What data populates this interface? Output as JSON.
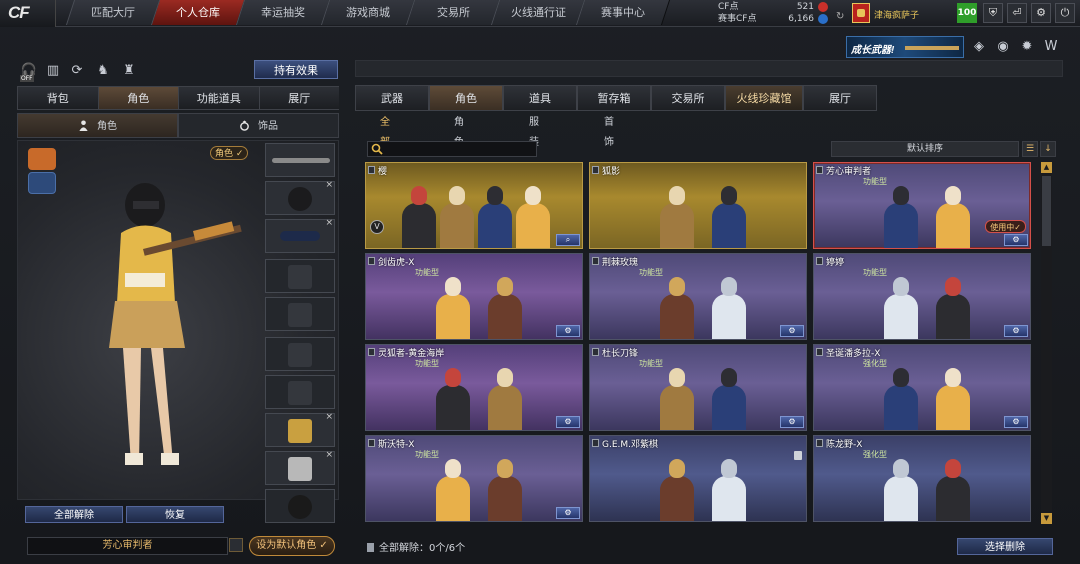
{
  "header": {
    "logo": "CF",
    "tabs": [
      {
        "label": "匹配大厅"
      },
      {
        "label": "个人仓库"
      },
      {
        "label": "幸运抽奖"
      },
      {
        "label": "游戏商城"
      },
      {
        "label": "交易所"
      },
      {
        "label": "火线通行证"
      },
      {
        "label": "赛事中心"
      }
    ],
    "active_tab": "个人仓库",
    "cf_points_label": "CF点",
    "cf_points_value": "521",
    "event_cf_points_label": "赛事CF点",
    "event_cf_points_value": "6,166",
    "refresh_icon": "refresh-icon",
    "username": "津海疯萨子",
    "level": "100",
    "right_icons": [
      "shield-icon",
      "back-icon",
      "settings-icon",
      "power-icon"
    ]
  },
  "promo": {
    "banner_text": "成长武器!",
    "icons": [
      "v-emblem-icon",
      "globe-icon",
      "gear-emblem-icon",
      "w-emblem-icon"
    ]
  },
  "left_panel": {
    "tool_icons": [
      "headset-off-icon",
      "stats-icon",
      "rotate-icon",
      "visibility-icon",
      "bag-icon"
    ],
    "off_label": "OFF",
    "effects_button": "持有效果",
    "tabs": [
      {
        "label": "背包"
      },
      {
        "label": "角色"
      },
      {
        "label": "功能道具"
      },
      {
        "label": "展厅"
      }
    ],
    "active_tab": "角色",
    "subtabs": [
      {
        "label": "角色",
        "icon": "person-icon"
      },
      {
        "label": "饰品",
        "icon": "ring-icon"
      }
    ],
    "role_tag": "角色 ✓",
    "slots": [
      {
        "name": "rifle-slot",
        "removable": false
      },
      {
        "name": "helmet-slot",
        "removable": true
      },
      {
        "name": "goggles-slot",
        "removable": true
      },
      {
        "name": "vest-slot",
        "removable": false
      },
      {
        "name": "armor-slot",
        "removable": false
      },
      {
        "name": "pack-slot",
        "removable": false
      },
      {
        "name": "belt-slot",
        "removable": false
      },
      {
        "name": "gold-knife-slot",
        "removable": true
      },
      {
        "name": "silver-knife-slot",
        "removable": true
      },
      {
        "name": "bracelet-slot",
        "removable": false
      }
    ],
    "unequip_all": "全部解除",
    "restore": "恢复",
    "character_name": "芳心审判者",
    "set_default": "设为默认角色"
  },
  "right_panel": {
    "tabs": [
      {
        "label": "武器"
      },
      {
        "label": "角色"
      },
      {
        "label": "道具"
      },
      {
        "label": "暂存箱"
      },
      {
        "label": "交易所"
      },
      {
        "label": "火线珍藏馆"
      },
      {
        "label": "展厅"
      }
    ],
    "active_tab": "角色",
    "filters": [
      {
        "label": "全部"
      },
      {
        "label": "角色"
      },
      {
        "label": "服装"
      },
      {
        "label": "首饰"
      }
    ],
    "active_filter": "全部",
    "search_placeholder": "",
    "sort_label": "默认排序",
    "cards": [
      {
        "name": "樱",
        "tag": "",
        "color": "gold",
        "figures": 4,
        "action": "search",
        "badge": "V",
        "in_use": ""
      },
      {
        "name": "狐影",
        "tag": "",
        "color": "gold",
        "figures": 2,
        "action": "",
        "badge": "",
        "in_use": ""
      },
      {
        "name": "芳心审判者",
        "tag": "功能型",
        "color": "purple",
        "figures": 2,
        "action": "gear",
        "badge": "",
        "in_use": "使用中✓",
        "selected": true
      },
      {
        "name": "剑齿虎-X",
        "tag": "功能型",
        "color": "violet",
        "figures": 2,
        "action": "gear",
        "badge": "",
        "in_use": ""
      },
      {
        "name": "荆棘玫瑰",
        "tag": "功能型",
        "color": "purple",
        "figures": 2,
        "action": "gear",
        "badge": "",
        "in_use": ""
      },
      {
        "name": "婷婷",
        "tag": "功能型",
        "color": "purple",
        "figures": 2,
        "action": "gear",
        "badge": "",
        "in_use": ""
      },
      {
        "name": "灵狐者-黄金海岸",
        "tag": "功能型",
        "color": "violet",
        "figures": 2,
        "action": "gear",
        "badge": "",
        "in_use": ""
      },
      {
        "name": "杜长刀锋",
        "tag": "功能型",
        "color": "purple",
        "figures": 2,
        "action": "gear",
        "badge": "",
        "in_use": ""
      },
      {
        "name": "圣诞潘多拉-X",
        "tag": "强化型",
        "color": "purple",
        "figures": 2,
        "action": "gear",
        "badge": "",
        "in_use": ""
      },
      {
        "name": "斯沃特-X",
        "tag": "功能型",
        "color": "purple",
        "figures": 2,
        "action": "gear",
        "badge": "",
        "in_use": ""
      },
      {
        "name": "G.E.M.邓紫棋",
        "tag": "",
        "color": "blue",
        "figures": 2,
        "action": "",
        "badge": "",
        "in_use": "",
        "locked": true
      },
      {
        "name": "陈龙野-X",
        "tag": "强化型",
        "color": "blue",
        "figures": 2,
        "action": "",
        "badge": "",
        "in_use": ""
      }
    ],
    "unequip_info_label": "全部解除：",
    "unequip_info_value": "0个/6个",
    "select_delete": "选择删除"
  },
  "colors": {
    "accent_red": "#9b2a22",
    "gold": "#c79a3c",
    "tab_active_brown": "#5e4b38",
    "button_blue": "#3c4f7e"
  }
}
